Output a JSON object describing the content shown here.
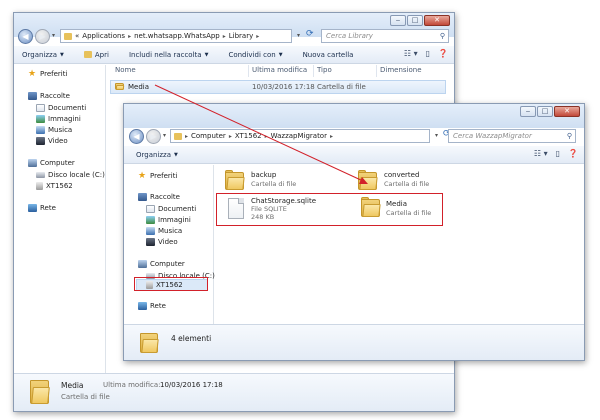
{
  "outer": {
    "address": {
      "overflow": "«",
      "parts": [
        "Applications",
        "net.whatsapp.WhatsApp",
        "Library"
      ]
    },
    "search_placeholder": "Cerca Library",
    "toolbar": [
      "Organizza",
      "Apri",
      "Includi nella raccolta",
      "Condividi con",
      "Nuova cartella"
    ],
    "columns": [
      "Nome",
      "Ultima modifica",
      "Tipo",
      "Dimensione"
    ],
    "row": {
      "name": "Media",
      "modified": "10/03/2016 17:18",
      "type": "Cartella di file",
      "size": ""
    },
    "nav": {
      "favorites": "Preferiti",
      "libraries": "Raccolte",
      "lib_items": [
        "Documenti",
        "Immagini",
        "Musica",
        "Video"
      ],
      "computer": "Computer",
      "comp_items": [
        "Disco locale (C:)",
        "XT1562"
      ],
      "network": "Rete"
    },
    "details": {
      "name": "Media",
      "modified_label": "Ultima modifica:",
      "modified": "10/03/2016 17:18",
      "type": "Cartella di file"
    }
  },
  "inner": {
    "address": {
      "parts": [
        "Computer",
        "XT1562",
        "WazzapMigrator"
      ]
    },
    "search_placeholder": "Cerca WazzapMigrator",
    "toolbar": [
      "Organizza"
    ],
    "nav": {
      "favorites": "Preferiti",
      "libraries": "Raccolte",
      "lib_items": [
        "Documenti",
        "Immagini",
        "Musica",
        "Video"
      ],
      "computer": "Computer",
      "comp_items": [
        "Disco locale (C:)",
        "XT1562"
      ],
      "network": "Rete"
    },
    "items": [
      {
        "name": "backup",
        "sub": "Cartella di file"
      },
      {
        "name": "converted",
        "sub": "Cartella di file"
      },
      {
        "name": "ChatStorage.sqlite",
        "sub": "File SQLITE",
        "size": "248 KB"
      },
      {
        "name": "Media",
        "sub": "Cartella di file"
      }
    ],
    "status": "4 elementi"
  },
  "colors": {
    "annotation": "#d2212a",
    "folder": "#e7c15b",
    "selection": "#dbe9f8"
  }
}
